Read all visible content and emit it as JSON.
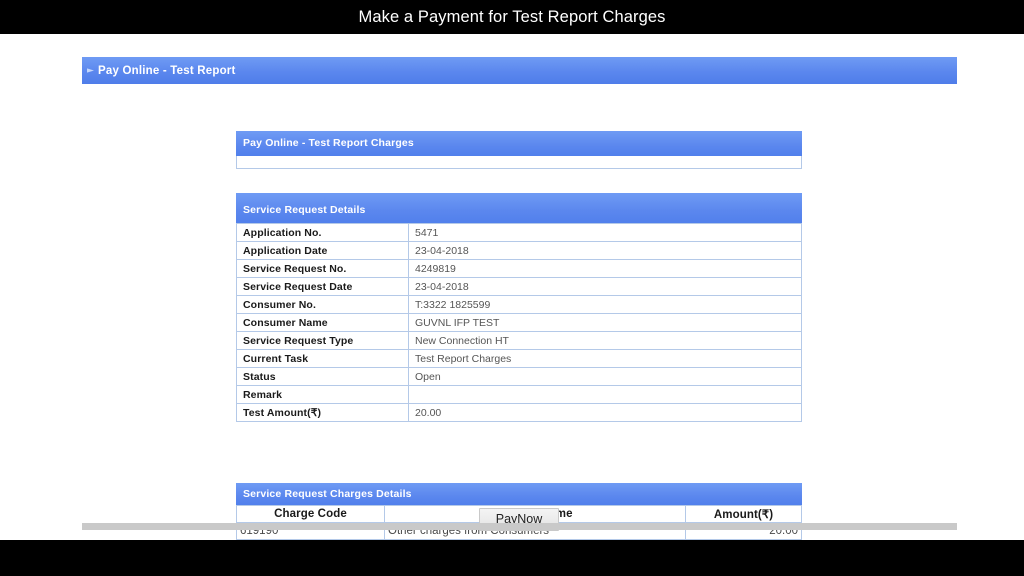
{
  "slide": {
    "title": "Make a Payment for Test Report Charges"
  },
  "app_bar": {
    "title": "Pay Online - Test Report",
    "marker_icon": "chevron-right-icon"
  },
  "pay_online_panel": {
    "header": "Pay Online - Test Report Charges"
  },
  "service_request_details": {
    "header": "Service Request Details",
    "rows": [
      {
        "label": "Application No.",
        "value": "5471"
      },
      {
        "label": "Application Date",
        "value": "23-04-2018"
      },
      {
        "label": "Service Request No.",
        "value": "4249819"
      },
      {
        "label": "Service Request Date",
        "value": "23-04-2018"
      },
      {
        "label": "Consumer No.",
        "value": "T:3322 1825599"
      },
      {
        "label": "Consumer Name",
        "value": "GUVNL IFP TEST"
      },
      {
        "label": "Service Request Type",
        "value": "New Connection HT"
      },
      {
        "label": "Current Task",
        "value": "Test Report Charges"
      },
      {
        "label": "Status",
        "value": "Open"
      },
      {
        "label": "Remark",
        "value": ""
      },
      {
        "label": "Test Amount(₹)",
        "value": "20.00"
      }
    ]
  },
  "charges_details": {
    "header": "Service Request Charges Details",
    "columns": [
      "Charge Code",
      "Charge Name",
      "Amount(₹)"
    ],
    "rows": [
      {
        "code": "619190",
        "name": "Other charges from Consumers",
        "amount": "20.00"
      }
    ]
  },
  "actions": {
    "paynow_accesskey": "P",
    "paynow_rest": "ayNow"
  },
  "colors": {
    "accent_blue": "#5b87ee",
    "border_blue": "#b4c9e8",
    "rail_grey": "#c9c9c9"
  }
}
